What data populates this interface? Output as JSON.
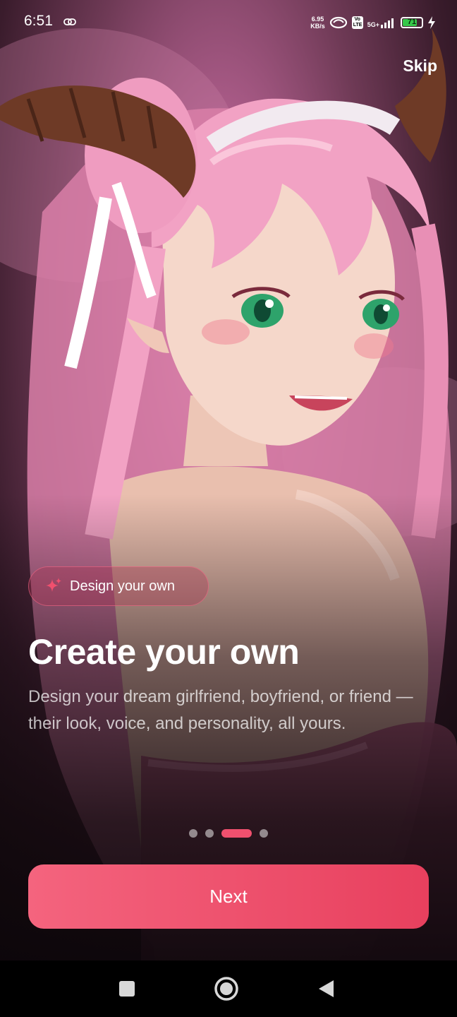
{
  "status_bar": {
    "time": "6:51",
    "net_speed_value": "6.95",
    "net_speed_unit": "KB/s",
    "volte_label": "Vo LTE",
    "network_label": "5G+",
    "battery_level": "71",
    "icons": [
      "link-icon",
      "hotspot-icon",
      "volte-icon",
      "signal-icon",
      "battery-icon",
      "charging-icon"
    ]
  },
  "skip_label": "Skip",
  "badge": {
    "icon": "sparkle-icon",
    "label": "Design your own"
  },
  "title": "Create your own",
  "description": "Design your dream girlfriend, boyfriend, or friend — their look, voice, and personality, all yours.",
  "pager": {
    "total": 4,
    "active_index": 2
  },
  "next_label": "Next",
  "nav_bar": {
    "icons": [
      "recents-square-icon",
      "home-circle-icon",
      "back-triangle-icon"
    ]
  },
  "colors": {
    "accent": "#f0506e",
    "button_start": "#f4647e",
    "button_end": "#e8405e",
    "battery": "#36c84a"
  }
}
